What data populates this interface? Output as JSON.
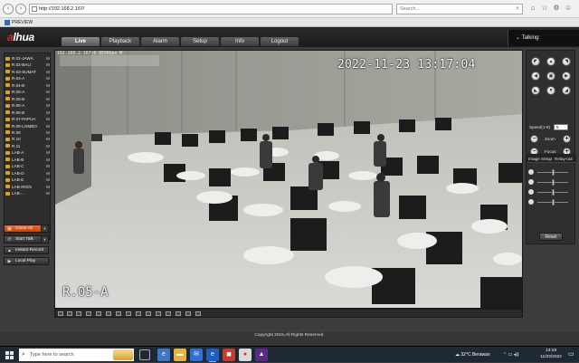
{
  "browser": {
    "url": "http://192.168.2.167/",
    "search_placeholder": "Search...",
    "tab_title": "PREVIEW"
  },
  "app": {
    "logo_text": "alhua",
    "menu": [
      "Live",
      "Playback",
      "Alarm",
      "Setup",
      "Info",
      "Logout"
    ],
    "talk_label": "Talking:"
  },
  "channels": [
    {
      "name": "R.01-JAWA",
      "flag": "M"
    },
    {
      "name": "R.02-BALI",
      "flag": "M"
    },
    {
      "name": "R.03-SUMAT",
      "flag": "M"
    },
    {
      "name": "R.04-A",
      "flag": "M"
    },
    {
      "name": "R.04-B",
      "flag": "M"
    },
    {
      "name": "R.05-A",
      "flag": "M"
    },
    {
      "name": "R.05-B",
      "flag": "M"
    },
    {
      "name": "R.06-A",
      "flag": "M"
    },
    {
      "name": "R.06-B",
      "flag": "M"
    },
    {
      "name": "R.07-PAPUA",
      "flag": "M"
    },
    {
      "name": "R.08-LOMBO",
      "flag": "M"
    },
    {
      "name": "R.09",
      "flag": "M"
    },
    {
      "name": "R.10",
      "flag": "M"
    },
    {
      "name": "R.11",
      "flag": "M"
    },
    {
      "name": "LAB-A",
      "flag": "M"
    },
    {
      "name": "LAB-B",
      "flag": "M"
    },
    {
      "name": "LAB-C",
      "flag": "M"
    },
    {
      "name": "LAB-D",
      "flag": "M"
    },
    {
      "name": "LAB-E",
      "flag": "M"
    },
    {
      "name": "LAB-IRGN",
      "flag": "M"
    },
    {
      "name": "LAB-...",
      "flag": "M"
    }
  ],
  "left_buttons": {
    "close_all": "Close All",
    "start_talk": "Start Talk",
    "instant_record": "Instant Record",
    "local_play": "Local Play"
  },
  "video": {
    "info_text": "192.168.2.167-6 955Kbps M",
    "timestamp": "2022-11-23 13:17:04",
    "camera_label": "R.05-A"
  },
  "ptz": {
    "speed_label": "Speed(1-8)",
    "speed_value": "5",
    "zoom_label": "Zoom",
    "focus_label": "Focus",
    "iris_label": "Iris"
  },
  "image_setup": {
    "title": "Image Setup",
    "relay_label": "Relay-out",
    "reset_label": "Reset"
  },
  "footer": {
    "copyright": "Copyright 2015,All Rights Reserved."
  },
  "taskbar": {
    "search_placeholder": "Type here to search",
    "weather": "32°C  Berawan",
    "time": "13:19",
    "date": "11/23/2022"
  }
}
